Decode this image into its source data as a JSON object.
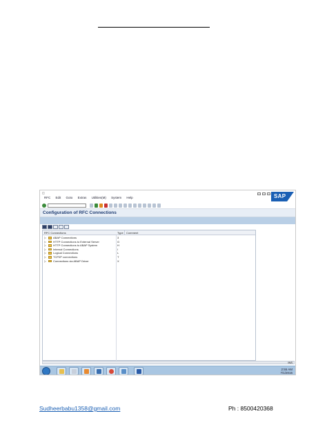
{
  "menu": {
    "items": [
      "RFC",
      "Edit",
      "Goto",
      "Extras",
      "Utilities(M)",
      "System",
      "Help"
    ]
  },
  "sap_logo": "SAP",
  "screen": {
    "title": "Configuration of RFC Connections"
  },
  "tree": {
    "columns": [
      "RFC Connections",
      "Type",
      "Comment"
    ],
    "rows": [
      {
        "label": "ABAP Connections",
        "type": "3"
      },
      {
        "label": "HTTP Connections to External Server",
        "type": "G"
      },
      {
        "label": "HTTP Connections to ABAP System",
        "type": "H"
      },
      {
        "label": "Internal Connections",
        "type": "I"
      },
      {
        "label": "Logical Connections",
        "type": "L"
      },
      {
        "label": "TCP/IP connections",
        "type": "T"
      },
      {
        "label": "Connections via ABAP Driver",
        "type": "X"
      }
    ]
  },
  "status": {
    "ins": "INS"
  },
  "taskbar": {
    "time": "2:55 AM",
    "date": "7/1/2016"
  },
  "footer": {
    "email": "Sudheerbabu1358@gmail.com",
    "phone": "Ph : 8500420368"
  },
  "colors": {
    "title_text": "#1f3d73",
    "app_toolbar": "#b9cfe6",
    "taskbar": "#a9c6e2",
    "link": "#1a5fb4",
    "sap_blue": "#1a5fb4"
  }
}
